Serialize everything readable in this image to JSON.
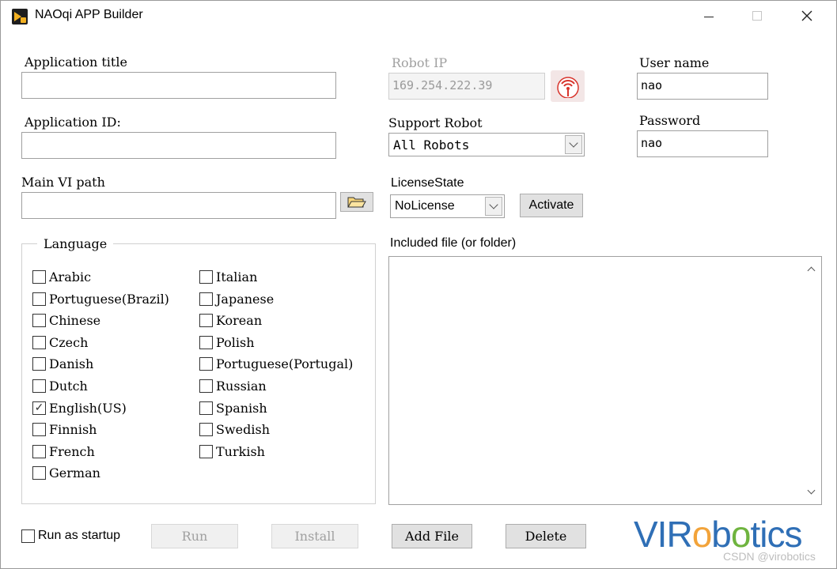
{
  "window": {
    "title": "NAOqi APP Builder"
  },
  "app_title": {
    "label": "Application title",
    "value": ""
  },
  "app_id": {
    "label": "Application ID:",
    "value": ""
  },
  "vi_path": {
    "label": "Main VI path",
    "value": ""
  },
  "robot_ip": {
    "label": "Robot IP",
    "value": "169.254.222.39"
  },
  "support_robot": {
    "label": "Support Robot",
    "value": "All Robots"
  },
  "license": {
    "label": "LicenseState",
    "value": "NoLicense",
    "activate_label": "Activate"
  },
  "user": {
    "label": "User name",
    "value": "nao"
  },
  "password": {
    "label": "Password",
    "value": "nao"
  },
  "language": {
    "title": "Language",
    "col1": [
      {
        "label": "Arabic",
        "checked": false
      },
      {
        "label": "Portuguese(Brazil)",
        "checked": false
      },
      {
        "label": "Chinese",
        "checked": false
      },
      {
        "label": "Czech",
        "checked": false
      },
      {
        "label": "Danish",
        "checked": false
      },
      {
        "label": "Dutch",
        "checked": false
      },
      {
        "label": "English(US)",
        "checked": true
      },
      {
        "label": "Finnish",
        "checked": false
      },
      {
        "label": "French",
        "checked": false
      },
      {
        "label": "German",
        "checked": false
      }
    ],
    "col2": [
      {
        "label": "Italian",
        "checked": false
      },
      {
        "label": "Japanese",
        "checked": false
      },
      {
        "label": "Korean",
        "checked": false
      },
      {
        "label": "Polish",
        "checked": false
      },
      {
        "label": "Portuguese(Portugal)",
        "checked": false
      },
      {
        "label": "Russian",
        "checked": false
      },
      {
        "label": "Spanish",
        "checked": false
      },
      {
        "label": "Swedish",
        "checked": false
      },
      {
        "label": "Turkish",
        "checked": false
      }
    ]
  },
  "included": {
    "label": "Included file (or folder)"
  },
  "bottom": {
    "run_startup_label": "Run as startup",
    "run_label": "Run",
    "install_label": "Install",
    "add_file_label": "Add File",
    "delete_label": "Delete"
  },
  "brand": {
    "part1": "VIR",
    "part2": "o",
    "part3": "b",
    "part4": "o",
    "part5": "tics"
  },
  "watermark": "CSDN @virobotics",
  "colors": {
    "brand_blue": "#2f6fb6",
    "brand_orange": "#f2a33a",
    "brand_green": "#6fb43f",
    "ping_red": "#d8342c"
  },
  "icons": {
    "folder": "folder-icon",
    "ping": "ping-icon"
  }
}
